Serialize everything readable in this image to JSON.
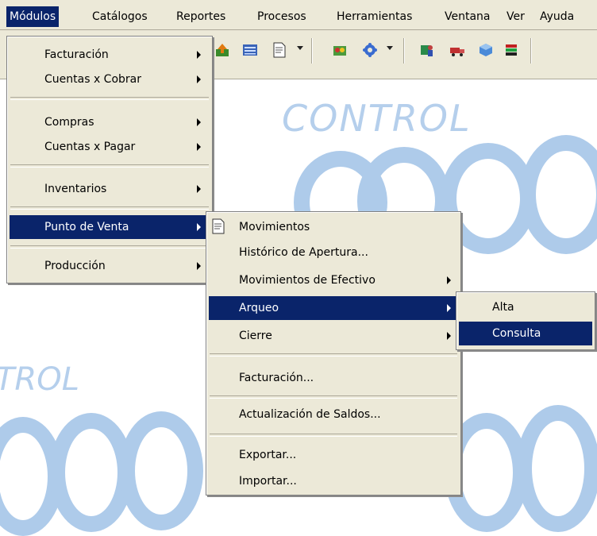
{
  "menubar": {
    "items": [
      "Módulos",
      "Catálogos",
      "Reportes",
      "Procesos",
      "Herramientas",
      "Ventana",
      "Ver",
      "Ayuda"
    ]
  },
  "toolbar": {
    "icons": [
      "upload-icon",
      "table-icon",
      "document-icon",
      "dropdown-arrow",
      "report-icon",
      "gear-icon",
      "dropdown-arrow",
      "person-icon",
      "truck-icon",
      "box-icon",
      "stack-icon"
    ]
  },
  "background": {
    "top_text": "CONTROL",
    "left_text": "TROL"
  },
  "modulos_menu": {
    "items": [
      "Facturación",
      "Cuentas x Cobrar",
      "Compras",
      "Cuentas x Pagar",
      "Inventarios",
      "Punto de Venta",
      "Producción"
    ],
    "highlighted": "Punto de Venta"
  },
  "punto_venta_menu": {
    "items": [
      "Movimientos",
      "Histórico de Apertura...",
      "Movimientos de Efectivo",
      "Arqueo",
      "Cierre",
      "Facturación...",
      "Actualización de Saldos...",
      "Exportar...",
      "Importar..."
    ],
    "highlighted": "Arqueo"
  },
  "arqueo_menu": {
    "items": [
      "Alta",
      "Consulta"
    ],
    "highlighted": "Consulta"
  },
  "colors": {
    "highlight": "#0a246a",
    "menu_bg": "#ece9d8",
    "logo_blue": "#aecbea"
  }
}
